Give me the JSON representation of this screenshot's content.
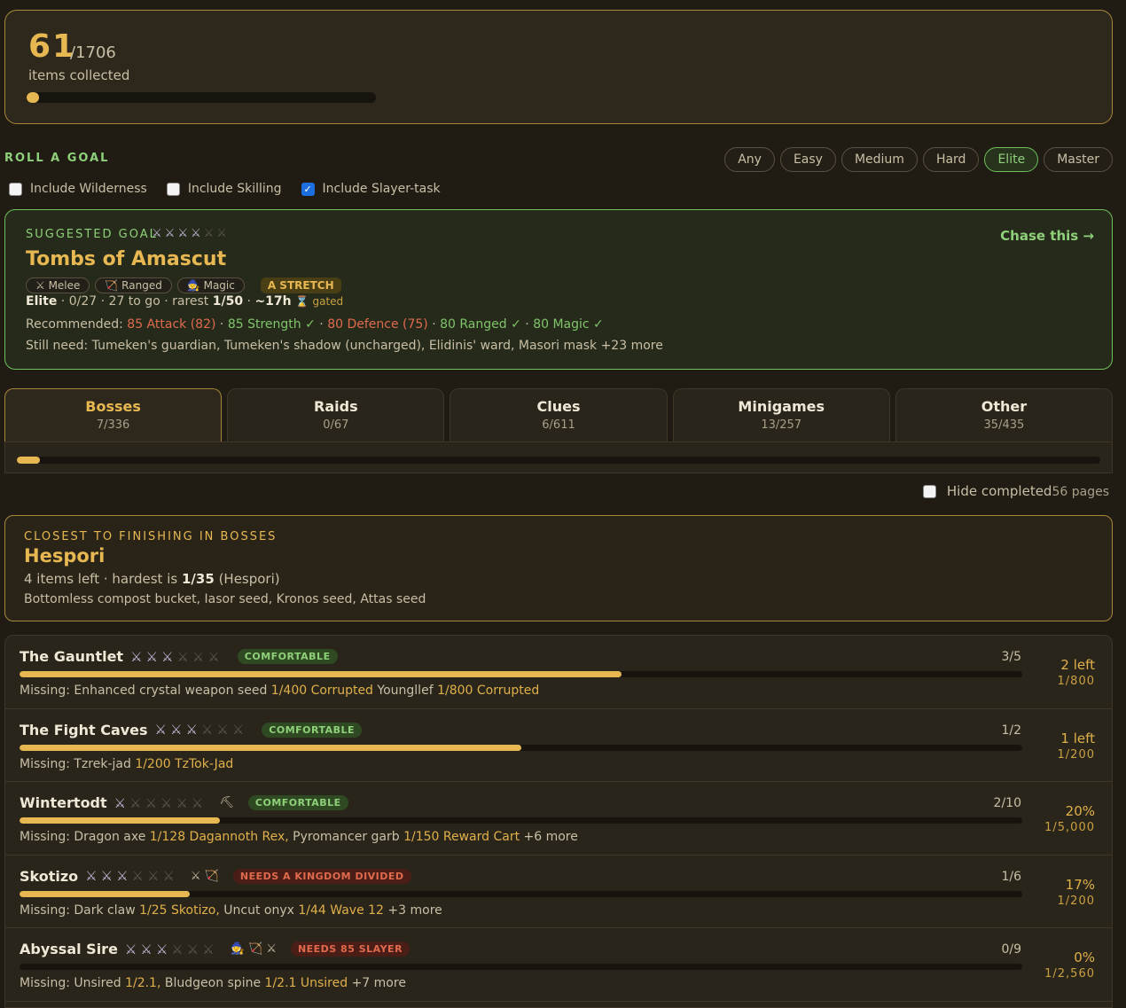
{
  "summary": {
    "collected": "61",
    "total": "/1706",
    "label": "items collected",
    "progress_pct": 3.6
  },
  "roll": {
    "label": "ROLL A GOAL",
    "difficulties": [
      "Any",
      "Easy",
      "Medium",
      "Hard",
      "Elite",
      "Master"
    ],
    "active_difficulty": "Elite",
    "options": [
      {
        "label": "Include Wilderness",
        "checked": false
      },
      {
        "label": "Include Skilling",
        "checked": false
      },
      {
        "label": "Include Slayer-task",
        "checked": true
      }
    ]
  },
  "goal": {
    "label": "SUGGESTED GOAL",
    "stars_filled": 4,
    "stars_total": 6,
    "chase": "Chase this →",
    "title": "Tombs of Amascut",
    "styles": [
      "Melee",
      "Ranged",
      "Magic"
    ],
    "stretch": "A STRETCH",
    "tier": "Elite",
    "progress": "0/27",
    "to_go": "27 to go",
    "rarest": "1/50",
    "time": "~17h",
    "gated": "gated",
    "recommended_label": "Recommended:",
    "recommended": [
      {
        "text": "85 Attack (82)",
        "ok": false
      },
      {
        "text": "85 Strength ✓",
        "ok": true
      },
      {
        "text": "80 Defence (75)",
        "ok": false
      },
      {
        "text": "80 Ranged ✓",
        "ok": true
      },
      {
        "text": "80 Magic ✓",
        "ok": true
      }
    ],
    "still_need": "Still need: Tumeken's guardian, Tumeken's shadow (uncharged), Elidinis' ward, Masori mask +23 more"
  },
  "tabs": [
    {
      "name": "Bosses",
      "count": "7/336",
      "active": true
    },
    {
      "name": "Raids",
      "count": "0/67",
      "active": false
    },
    {
      "name": "Clues",
      "count": "6/611",
      "active": false
    },
    {
      "name": "Minigames",
      "count": "13/257",
      "active": false
    },
    {
      "name": "Other",
      "count": "35/435",
      "active": false
    }
  ],
  "tab_progress_pct": 2.1,
  "hide_completed": {
    "label": "Hide completed",
    "pages": "56 pages",
    "checked": false
  },
  "closest": {
    "label": "CLOSEST TO FINISHING IN BOSSES",
    "title": "Hespori",
    "items_left": "4 items left",
    "hardest_label": "hardest is",
    "hardest_rate": "1/35",
    "hardest_source": "(Hespori)",
    "items": "Bottomless compost bucket, Iasor seed, Kronos seed, Attas seed"
  },
  "bosses": [
    {
      "name": "The Gauntlet",
      "stars_filled": 3,
      "stars_total": 6,
      "styles": "",
      "badge": "COMFORTABLE",
      "badge_kind": "ok",
      "count": "3/5",
      "progress_pct": 60,
      "missing_prefix": "Missing:",
      "missing": [
        {
          "item": "Enhanced crystal weapon seed",
          "rate": "1/400 Corrupted"
        },
        {
          "item": "Youngllef",
          "rate": "1/800 Corrupted"
        }
      ],
      "more": "",
      "left": "2 left",
      "left_rate": "1/800"
    },
    {
      "name": "The Fight Caves",
      "stars_filled": 3,
      "stars_total": 6,
      "styles": "",
      "badge": "COMFORTABLE",
      "badge_kind": "ok",
      "count": "1/2",
      "progress_pct": 50,
      "missing_prefix": "Missing:",
      "missing": [
        {
          "item": "Tzrek-jad",
          "rate": "1/200 TzTok-Jad"
        }
      ],
      "more": "",
      "left": "1 left",
      "left_rate": "1/200"
    },
    {
      "name": "Wintertodt",
      "stars_filled": 1,
      "stars_total": 6,
      "styles": "⛏",
      "badge": "COMFORTABLE",
      "badge_kind": "ok",
      "count": "2/10",
      "progress_pct": 20,
      "missing_prefix": "Missing:",
      "missing": [
        {
          "item": "Dragon axe",
          "rate": "1/128 Dagannoth Rex,"
        },
        {
          "item": "Pyromancer garb",
          "rate": "1/150 Reward Cart"
        }
      ],
      "more": "+6 more",
      "left": "20%",
      "left_rate": "1/5,000"
    },
    {
      "name": "Skotizo",
      "stars_filled": 3,
      "stars_total": 6,
      "styles": "⚔ 🏹",
      "badge": "NEEDS A KINGDOM DIVIDED",
      "badge_kind": "need",
      "count": "1/6",
      "progress_pct": 17,
      "missing_prefix": "Missing:",
      "missing": [
        {
          "item": "Dark claw",
          "rate": "1/25 Skotizo,"
        },
        {
          "item": "Uncut onyx",
          "rate": "1/44 Wave 12"
        }
      ],
      "more": "+3 more",
      "left": "17%",
      "left_rate": "1/200"
    },
    {
      "name": "Abyssal Sire",
      "stars_filled": 3,
      "stars_total": 6,
      "styles": "🧙 🏹 ⚔",
      "badge": "NEEDS 85 SLAYER",
      "badge_kind": "need",
      "count": "0/9",
      "progress_pct": 0,
      "missing_prefix": "Missing:",
      "missing": [
        {
          "item": "Unsired",
          "rate": "1/2.1,"
        },
        {
          "item": "Bludgeon spine",
          "rate": "1/2.1 Unsired"
        }
      ],
      "more": "+7 more",
      "left": "0%",
      "left_rate": "1/2,560"
    }
  ]
}
